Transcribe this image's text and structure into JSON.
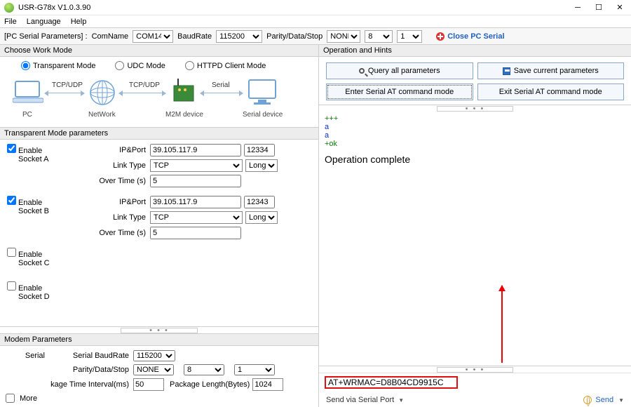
{
  "window": {
    "title": "USR-G78x V1.0.3.90"
  },
  "menu": {
    "file": "File",
    "language": "Language",
    "help": "Help"
  },
  "pc_serial": {
    "header": "[PC Serial Parameters] :",
    "comname_lbl": "ComName",
    "comname": "COM14",
    "baud_lbl": "BaudRate",
    "baud": "115200",
    "pds_lbl": "Parity/Data/Stop",
    "parity": "NONE",
    "data": "8",
    "stop": "1",
    "close": "Close PC Serial"
  },
  "left": {
    "choose_mode": "Choose Work Mode",
    "modes": {
      "transparent": "Transparent Mode",
      "udc": "UDC Mode",
      "httpd": "HTTPD Client Mode"
    },
    "diagram": {
      "tcpudp": "TCP/UDP",
      "serial": "Serial",
      "pc": "PC",
      "network": "NetWork",
      "m2m": "M2M device",
      "sd": "Serial device"
    },
    "params_hdr": "Transparent Mode parameters",
    "labels": {
      "enable": "Enable",
      "sA": "Socket A",
      "sB": "Socket B",
      "sC": "Socket C",
      "sD": "Socket D",
      "ipport": "IP&Port",
      "linktype": "Link Type",
      "overtime": "Over Time (s)"
    },
    "socketA": {
      "enabled": true,
      "ip": "39.105.117.9",
      "port": "12334",
      "link": "TCP",
      "mode": "Long",
      "over": "5"
    },
    "socketB": {
      "enabled": true,
      "ip": "39.105.117.9",
      "port": "12343",
      "link": "TCP",
      "mode": "Long",
      "over": "5"
    },
    "socketC": {
      "enabled": false
    },
    "socketD": {
      "enabled": false
    },
    "modem_hdr": "Modem Parameters",
    "modem": {
      "serial_lbl": "Serial",
      "baud_lbl": "Serial BaudRate",
      "baud": "115200",
      "pds_lbl": "Parity/Data/Stop",
      "parity": "NONE",
      "data": "8",
      "stop": "1",
      "pkg_time_lbl": "kage Time Interval(ms)",
      "pkg_time": "50",
      "pkg_len_lbl": "Package Length(Bytes)",
      "pkg_len": "1024",
      "more": "More"
    }
  },
  "right": {
    "hdr": "Operation and Hints",
    "btns": {
      "query": "Query all parameters",
      "save": "Save current parameters",
      "enter": "Enter Serial AT command mode",
      "exit": "Exit Serial AT command mode"
    },
    "log": {
      "l1": "+++",
      "l2": "a",
      "l3": "a",
      "l4": "+ok",
      "complete": "Operation complete"
    },
    "cmd": "AT+WRMAC=D8B04CD9915C",
    "send_via": "Send via Serial Port",
    "send": "Send"
  }
}
